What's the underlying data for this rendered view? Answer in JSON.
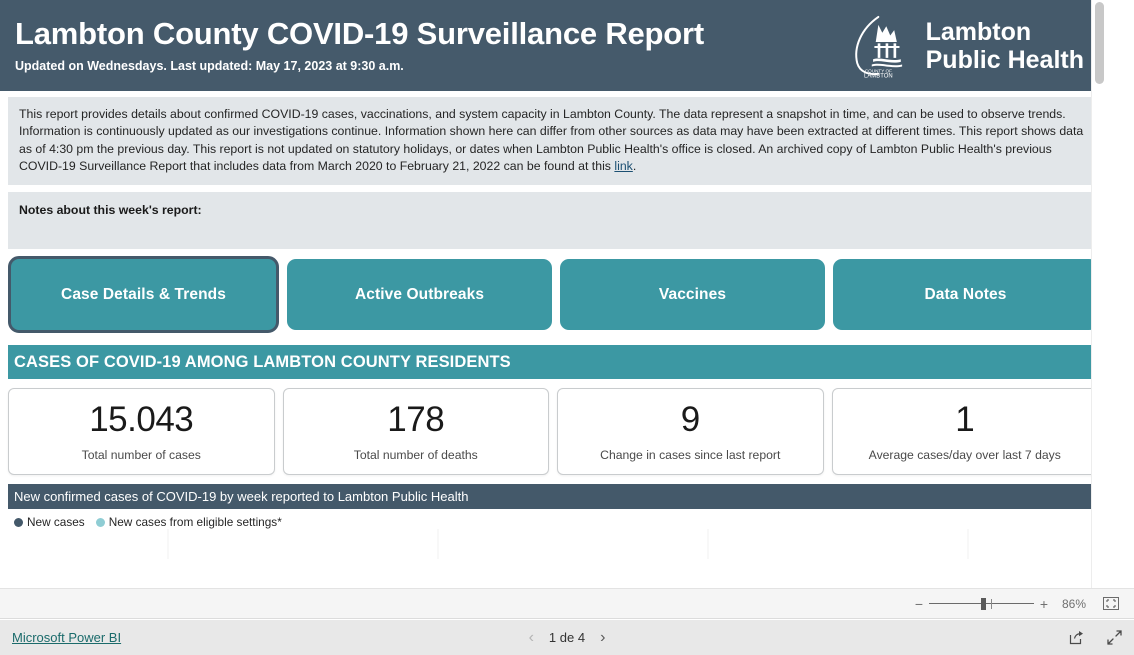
{
  "header": {
    "title": "Lambton County COVID-19 Surveillance Report",
    "subtitle": "Updated on Wednesdays. Last updated: May 17, 2023 at 9:30 a.m.",
    "brand_line1": "Lambton",
    "brand_line2": "Public Health",
    "brand_mark_caption_top": "COUNTY OF",
    "brand_mark_caption_bottom": "LAMBTON",
    "background_color": "#455a6b"
  },
  "info_panel": {
    "text_before_link": "This report provides details about confirmed COVID-19 cases, vaccinations, and system capacity in Lambton County. The data represent a snapshot in time, and can be used to observe trends. Information is continuously updated as our investigations continue. Information shown here can differ from other sources as data may have been extracted at different times. This report shows data as of 4:30 pm the previous day. This report is not updated on statutory holidays, or dates when Lambton Public Health's office is closed. An archived copy of Lambton Public Health's previous COVID-19 Surveillance Report that includes data from March 2020 to February 21, 2022 can be found at this ",
    "link_label": "link",
    "text_after_link": "."
  },
  "notes_panel": {
    "label": "Notes about this week's report:",
    "body": ""
  },
  "tabs": [
    {
      "label": "Case Details & Trends",
      "selected": true
    },
    {
      "label": "Active Outbreaks",
      "selected": false
    },
    {
      "label": "Vaccines",
      "selected": false
    },
    {
      "label": "Data Notes",
      "selected": false
    }
  ],
  "section_banner": {
    "title": "CASES OF COVID-19 AMONG LAMBTON COUNTY RESIDENTS",
    "color": "#3c98a3"
  },
  "kpis": [
    {
      "value": "15.043",
      "label": "Total number of cases"
    },
    {
      "value": "178",
      "label": "Total number of deaths"
    },
    {
      "value": "9",
      "label": "Change in cases since last report"
    },
    {
      "value": "1",
      "label": "Average cases/day over last 7 days"
    }
  ],
  "chart_data": {
    "type": "bar",
    "title": "New confirmed cases of COVID-19 by week reported to Lambton Public Health",
    "xlabel": "",
    "ylabel": "",
    "categories": [],
    "series": [
      {
        "name": "New cases",
        "color": "#44596a",
        "values": []
      },
      {
        "name": "New cases from eligible settings*",
        "color": "#8fcdd4",
        "values": []
      }
    ],
    "legend_position": "top-left",
    "grid": true,
    "note": "Chart plot area is cut off at the bottom edge of the viewport; only the title bar, legend and the top of the plot canvas are visible."
  },
  "zoom_toolbar": {
    "minus_label": "−",
    "plus_label": "+",
    "percent": "86%",
    "fit_icon": "fit-to-page-icon"
  },
  "footer": {
    "brand_link": "Microsoft Power BI",
    "prev_label": "‹",
    "page_label": "1 de 4",
    "next_label": "›",
    "share_icon": "share-icon",
    "fullscreen_icon": "fullscreen-icon"
  }
}
